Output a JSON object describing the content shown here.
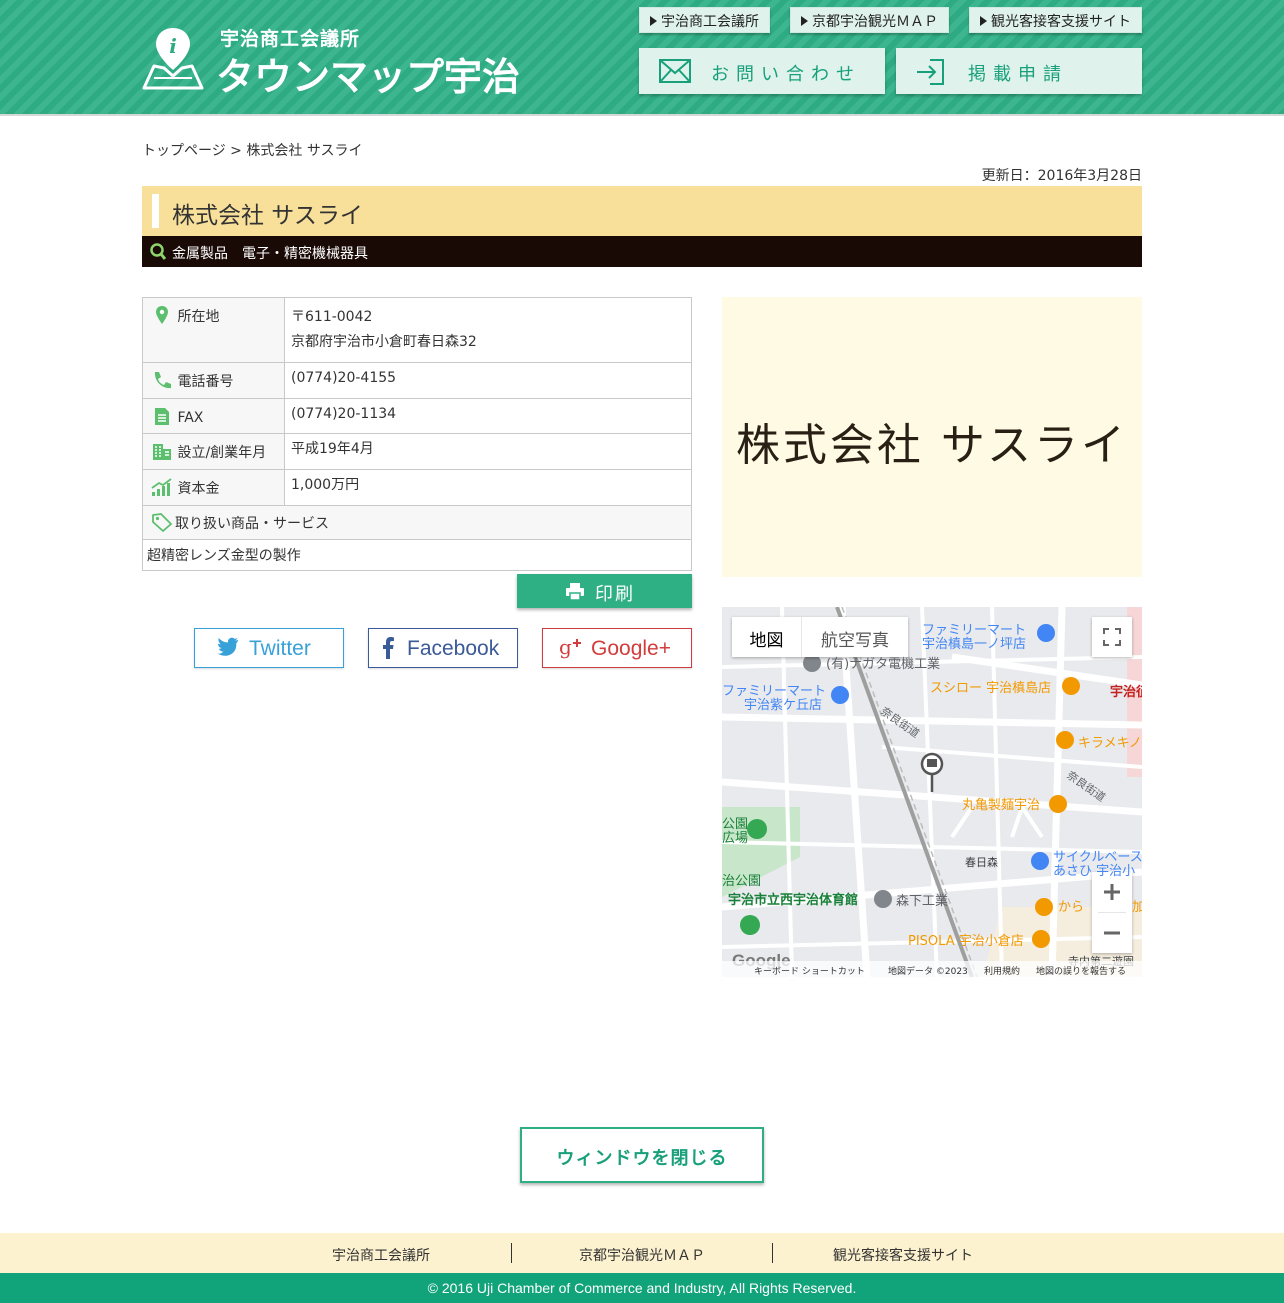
{
  "header": {
    "logo_sub": "宇治商工会議所",
    "logo_main": "タウンマップ宇治",
    "top_links": [
      "宇治商工会議所",
      "京都宇治観光ＭＡＰ",
      "観光客接客支援サイト"
    ],
    "contact_label": "お問い合わせ",
    "apply_label": "掲載申請"
  },
  "breadcrumb": {
    "home": "トップページ",
    "sep": " > ",
    "current": "株式会社 サスライ"
  },
  "updated": "更新日：2016年3月28日",
  "company": {
    "name": "株式会社 サスライ",
    "category": "金属製品　電子・精密機械器具",
    "logo_text": "株式会社 サスライ"
  },
  "info": {
    "address_label": "所在地",
    "postal": "〒611-0042",
    "address": "京都府宇治市小倉町春日森32",
    "phone_label": "電話番号",
    "phone": "(0774)20-4155",
    "fax_label": "FAX",
    "fax": "(0774)20-1134",
    "founded_label": "設立/創業年月",
    "founded": "平成19年4月",
    "capital_label": "資本金",
    "capital": "1,000万円",
    "products_label": "取り扱い商品・サービス",
    "products": "超精密レンズ金型の製作"
  },
  "print_label": "印刷",
  "share": {
    "twitter": "Twitter",
    "facebook": "Facebook",
    "google": "Google+"
  },
  "map": {
    "tab_map": "地図",
    "tab_aerial": "航空写真",
    "labels": {
      "fm1a": "ファミリーマート",
      "fm1b": "宇治槙島一ノ坪店",
      "nagata": "(有)ナガタ電機工業",
      "fm2a": "ファミリーマート",
      "fm2b": "宇治紫ケ丘店",
      "sushiro": "スシロー 宇治槙島店",
      "uji_edge": "宇治征",
      "kirameki": "キラメキノ",
      "nara1": "奈良街道",
      "nara2": "奈良街道",
      "marugame": "丸亀製麺宇治",
      "park1": "公園",
      "park2": "広場",
      "kasugamori": "春日森",
      "cycle1": "サイクルベース",
      "cycle2": "あさひ 宇治小",
      "ujipark": "治公園",
      "gym": "宇治市立西宇治体育館",
      "morishita": "森下工業",
      "karayoshi": "から",
      "ka": "加",
      "pisola": "PISOLA 宇治小倉店",
      "terauchi": "寺内第二遊園"
    },
    "footer": {
      "google": "Google",
      "shortcut": "キーボード ショートカット",
      "data": "地図データ ©2023",
      "terms": "利用規約",
      "report": "地図の誤りを報告する"
    },
    "colors": {
      "road_highway": "#ffffff",
      "park": "#c8e6c9",
      "poi_food": "#f29900",
      "poi_shop": "#4285f4",
      "poi_place": "#34a853"
    }
  },
  "close_label": "ウィンドウを閉じる",
  "footer": {
    "links": [
      "宇治商工会議所",
      "京都宇治観光ＭＡＰ",
      "観光客接客支援サイト"
    ],
    "copyright": "© 2016 Uji Chamber of Commerce and Industry, All Rights Reserved."
  },
  "colors": {
    "brand_green": "#2eab83",
    "title_bg": "#f8e09b",
    "category_bg": "#1a0a05",
    "logo_bg": "#fefae4",
    "footer_nav_bg": "#fdf2cf",
    "copyright_bg": "#11a379"
  }
}
